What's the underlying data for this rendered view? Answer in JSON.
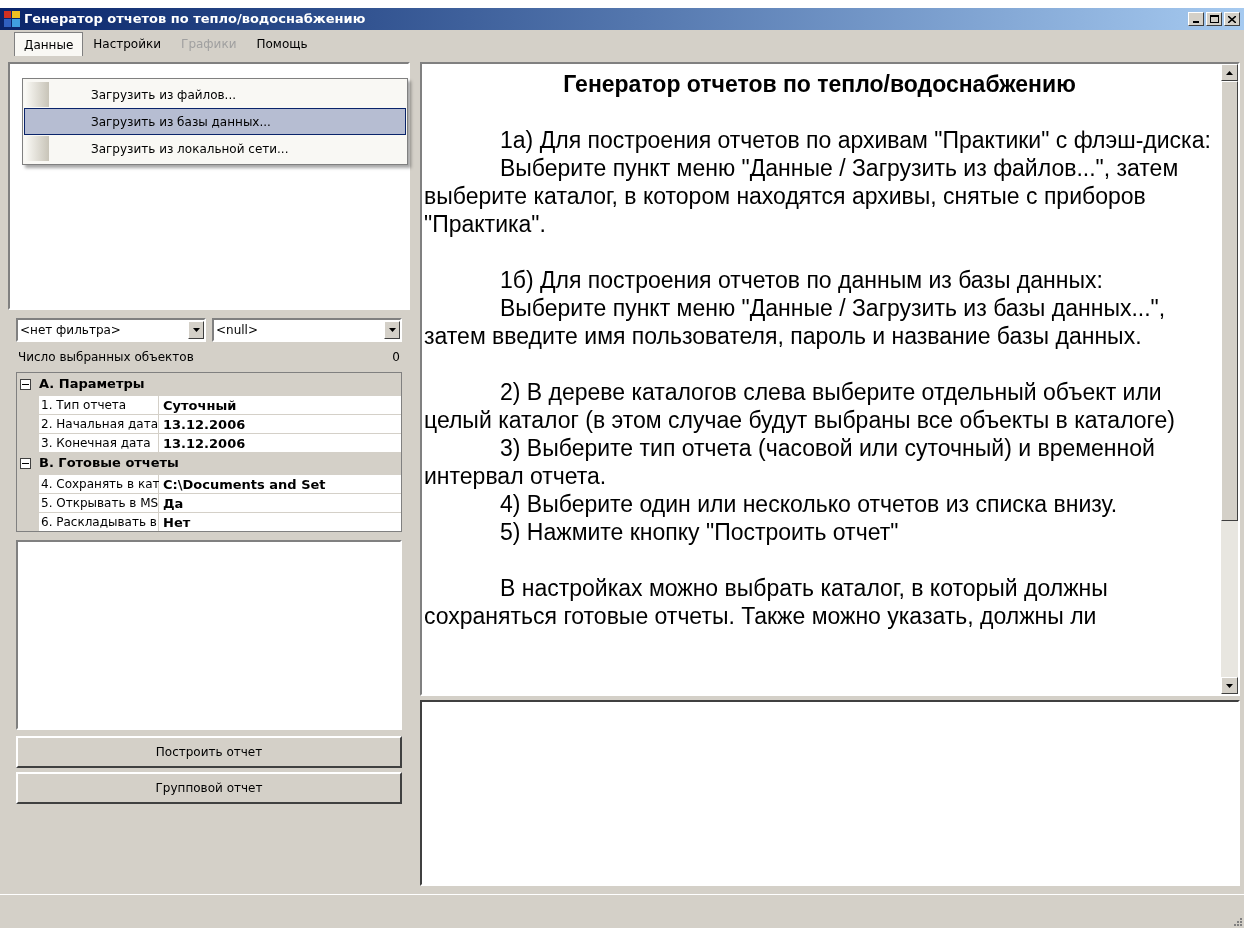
{
  "window": {
    "title": "Генератор отчетов по тепло/водоснабжению"
  },
  "menu": [
    {
      "label": "Данные",
      "selected": true,
      "disabled": false
    },
    {
      "label": "Настройки",
      "selected": false,
      "disabled": false
    },
    {
      "label": "Графики",
      "selected": false,
      "disabled": true
    },
    {
      "label": "Помощь",
      "selected": false,
      "disabled": false
    }
  ],
  "dropdown": [
    {
      "label": "Загрузить из файлов...",
      "selected": false
    },
    {
      "label": "Загрузить из базы данных...",
      "selected": true
    },
    {
      "label": "Загрузить из локальной сети...",
      "selected": false
    }
  ],
  "filters": [
    {
      "value": "<нет фильтра>"
    },
    {
      "value": "<null>"
    }
  ],
  "selected_count": {
    "label": "Число выбранных объектов",
    "value": "0"
  },
  "properties": [
    {
      "category": "A. Параметры",
      "expanded": true,
      "rows": [
        {
          "name": "1. Тип отчета",
          "value": "Суточный"
        },
        {
          "name": "2. Начальная дата",
          "value": "13.12.2006"
        },
        {
          "name": "3. Конечная дата",
          "value": "13.12.2006"
        }
      ]
    },
    {
      "category": "B. Готовые отчеты",
      "expanded": true,
      "rows": [
        {
          "name": "4. Сохранять в кат",
          "value": "C:\\Documents and Set"
        },
        {
          "name": "5. Открывать в MS",
          "value": "Да"
        },
        {
          "name": "6. Раскладывать в",
          "value": "Нет"
        }
      ]
    }
  ],
  "buttons": [
    "Построить отчет",
    "Групповой отчет"
  ],
  "help": {
    "title": "Генератор отчетов по тепло/водоснабжению",
    "sections": [
      [
        "1а) Для построения отчетов по архивам \"Практики\" с флэш-диска:",
        "Выберите пункт меню \"Данные / Загрузить из файлов...\", затем выберите каталог, в котором находятся архивы, снятые с приборов \"Практика\"."
      ],
      [
        "1б) Для построения отчетов по данным из базы данных:",
        "Выберите пункт меню \"Данные / Загрузить из базы данных...\", затем введите имя пользователя, пароль и название базы данных."
      ],
      [
        "2) В дереве каталогов слева выберите отдельный объект или целый каталог (в этом случае будут выбраны все объекты в каталоге)",
        "3) Выберите тип отчета (часовой или суточный) и временной интервал отчета.",
        "4) Выберите один или несколько отчетов из списка внизу.",
        "5) Нажмите кнопку \"Построить отчет\""
      ],
      [
        "В настройках можно выбрать каталог, в который должны сохраняться готовые отчеты. Также можно указать, должны ли"
      ]
    ]
  }
}
